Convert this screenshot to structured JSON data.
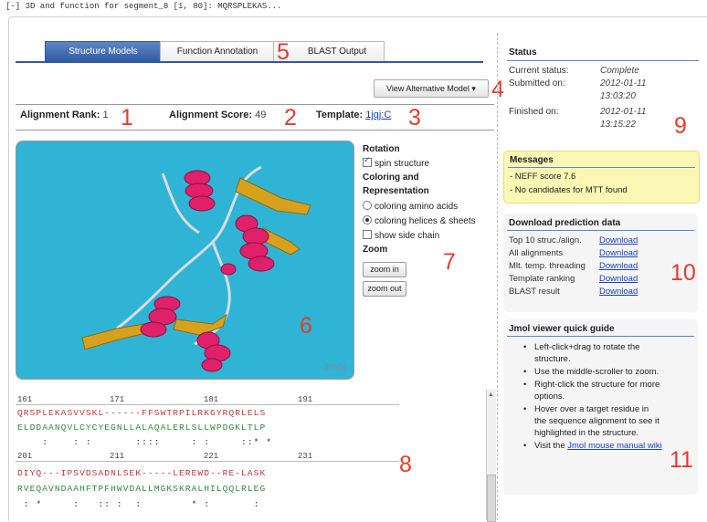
{
  "header": {
    "title": "[-] 3D and function for segment_8 [1, 80]: MQRSPLEKAS..."
  },
  "tabs": [
    {
      "label": "Structure Models",
      "active": true
    },
    {
      "label": "Function Annotation",
      "active": false
    },
    {
      "label": "BLAST Output",
      "active": false
    }
  ],
  "view_alt_button": "View Alternative Model ▾",
  "alignment_info": {
    "rank_label": "Alignment Rank:",
    "rank_value": "1",
    "score_label": "Alignment Score:",
    "score_value": "49",
    "template_label": "Template:",
    "template_value": "1jqj:C"
  },
  "viewer": {
    "watermark": "Jmol"
  },
  "controls": {
    "rotation_title": "Rotation",
    "spin_label": "spin structure",
    "spin_checked": true,
    "coloring_title_1": "Coloring and",
    "coloring_title_2": "Representation",
    "opt_amino": "coloring amino acids",
    "opt_helices": "coloring helices & sheets",
    "selected_coloring": "coloring helices & sheets",
    "side_chain": "show side chain",
    "side_chain_checked": false,
    "zoom_title": "Zoom",
    "zoom_in": "zoom in",
    "zoom_out": "zoom out"
  },
  "alignment": {
    "block1": {
      "ruler": [
        "161",
        "171",
        "181",
        "191"
      ],
      "seq1": "QRSPLEKASVVSKL------FFSWTRPILRKGYRQRLELS",
      "seq2": "ELDDAANQVLCYCYEGNLLALAQALERLSLLWPDGKLTLP",
      "cons": "    :    : :       ::::     : :     ::* *"
    },
    "block2": {
      "ruler": [
        "201",
        "211",
        "221",
        "231"
      ],
      "seq1": "DIYQ---IPSVDSADNLSEK-----LEREWD--RE-LASK",
      "seq2": "RVEQAVNDAAHFTPFHWVDALLMGKSKRALHILQQLRLEG",
      "cons": " : *     :   :: :  :        * :       :"
    }
  },
  "status": {
    "title": "Status",
    "current_label": "Current status:",
    "current_value": "Complete",
    "submitted_label": "Submitted on:",
    "submitted_date": "2012-01-11",
    "submitted_time": "13:03:20",
    "finished_label": "Finished on:",
    "finished_date": "2012-01-11",
    "finished_time": "13:15:22"
  },
  "messages": {
    "title": "Messages",
    "items": [
      "- NEFF score 7.6",
      "- No candidates for MTT found"
    ]
  },
  "download": {
    "title": "Download prediction data",
    "rows": [
      {
        "label": "Top 10 struc./align.",
        "link": "Download"
      },
      {
        "label": "All alignments",
        "link": "Download"
      },
      {
        "label": "Mlt. temp. threading",
        "link": "Download"
      },
      {
        "label": "Template ranking",
        "link": "Download"
      },
      {
        "label": "BLAST result",
        "link": "Download"
      }
    ]
  },
  "guide": {
    "title": "Jmol viewer quick guide",
    "items": [
      "Left-click+drag to rotate the structure.",
      "Use the middle-scroller to zoom.",
      "Right-click the structure for more options.",
      "Hover over a target residue in the sequence alignment to see it highlighted in the structure."
    ],
    "last_prefix": "Visit the ",
    "last_link": "Jmol mouse manual wiki"
  },
  "markers": [
    "1",
    "2",
    "3",
    "4",
    "5",
    "6",
    "7",
    "8",
    "9",
    "10",
    "11"
  ],
  "colors": {
    "tab_active": "#2f5aa3",
    "marker": "#e23c2c",
    "viewer_bg": "#2fb4d6",
    "helix": "#e0206a",
    "sheet": "#d6a21e",
    "message_bg": "#fbf7b5",
    "link": "#1a3fbf"
  }
}
